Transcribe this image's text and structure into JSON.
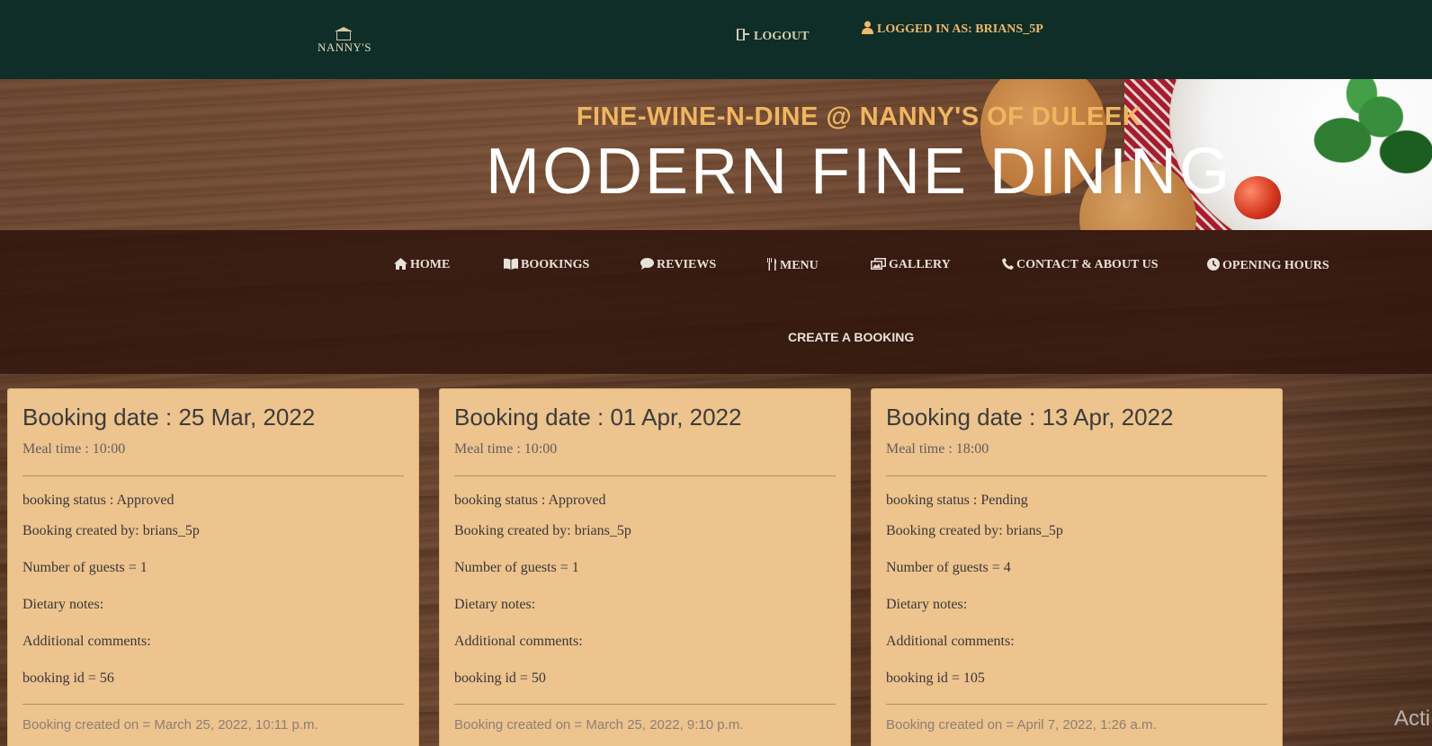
{
  "header": {
    "logo_text": "NANNY'S",
    "logout_label": "LOGOUT",
    "logged_in_label": "LOGGED IN AS: BRIANS_5P"
  },
  "hero": {
    "subtitle": "FINE-WINE-N-DINE @ NANNY'S OF DULEEK",
    "title": "MODERN FINE DINING"
  },
  "nav": {
    "items": [
      {
        "label": "HOME",
        "icon": "home-icon"
      },
      {
        "label": "BOOKINGS",
        "icon": "book-icon"
      },
      {
        "label": "REVIEWS",
        "icon": "comment-icon"
      },
      {
        "label": "MENU",
        "icon": "cutlery-icon"
      },
      {
        "label": "GALLERY",
        "icon": "images-icon"
      },
      {
        "label": "CONTACT & ABOUT US",
        "icon": "phone-icon"
      },
      {
        "label": "OPENING HOURS",
        "icon": "clock-icon"
      }
    ],
    "create_label": "CREATE A BOOKING"
  },
  "bookings": [
    {
      "date": "Booking date : 25 Mar, 2022",
      "meal_time": "Meal time : 10:00",
      "status": "booking status : Approved",
      "created_by": "Booking created by: brians_5p",
      "guests": "Number of guests = 1",
      "dietary": "Dietary notes:",
      "comments": "Additional comments:",
      "booking_id": "booking id = 56",
      "created_on": "Booking created on = March 25, 2022, 10:11 p.m."
    },
    {
      "date": "Booking date : 01 Apr, 2022",
      "meal_time": "Meal time : 10:00",
      "status": "booking status : Approved",
      "created_by": "Booking created by: brians_5p",
      "guests": "Number of guests = 1",
      "dietary": "Dietary notes:",
      "comments": "Additional comments:",
      "booking_id": "booking id = 50",
      "created_on": "Booking created on = March 25, 2022, 9:10 p.m."
    },
    {
      "date": "Booking date : 13 Apr, 2022",
      "meal_time": "Meal time : 18:00",
      "status": "booking status : Pending",
      "created_by": "Booking created by: brians_5p",
      "guests": "Number of guests = 4",
      "dietary": "Dietary notes:",
      "comments": "Additional comments:",
      "booking_id": "booking id = 105",
      "created_on": "Booking created on = April 7, 2022, 1:26 a.m."
    }
  ],
  "watermark": "Acti",
  "colors": {
    "topbar": "#0f2e27",
    "accent": "#f0b65f",
    "card": "#edc38e"
  }
}
